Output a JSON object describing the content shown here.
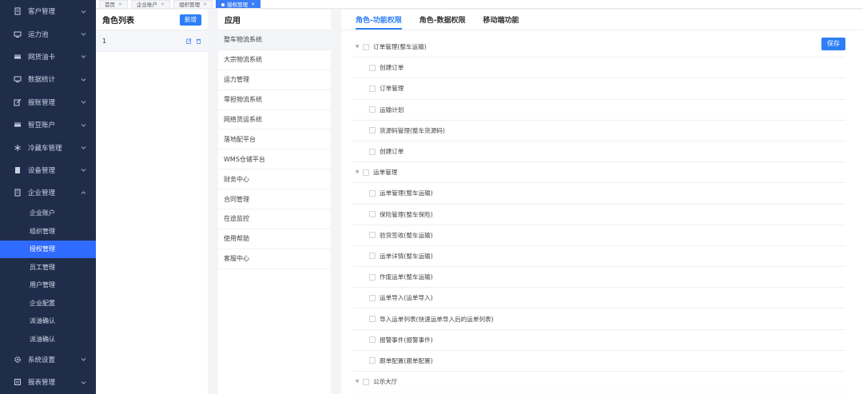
{
  "sidebar": {
    "items": [
      {
        "label": "客户管理",
        "icon": "document-icon",
        "expanded": false
      },
      {
        "label": "运力池",
        "icon": "monitor-icon",
        "expanded": false
      },
      {
        "label": "网货油卡",
        "icon": "card-icon",
        "expanded": false
      },
      {
        "label": "数据统计",
        "icon": "monitor-icon",
        "expanded": false
      },
      {
        "label": "报账管理",
        "icon": "edit-icon",
        "expanded": false
      },
      {
        "label": "智豆账户",
        "icon": "card-icon",
        "expanded": false
      },
      {
        "label": "冷藏车管理",
        "icon": "snowflake-icon",
        "expanded": false
      },
      {
        "label": "设备管理",
        "icon": "device-icon",
        "expanded": false
      },
      {
        "label": "企业管理",
        "icon": "building-icon",
        "expanded": true
      }
    ],
    "subitems": [
      {
        "label": "企业账户",
        "active": false
      },
      {
        "label": "组织管理",
        "active": false
      },
      {
        "label": "授权管理",
        "active": true
      },
      {
        "label": "员工管理",
        "active": false
      },
      {
        "label": "用户管理",
        "active": false
      },
      {
        "label": "企业配置",
        "active": false
      },
      {
        "label": "派油确认",
        "active": false
      },
      {
        "label": "派油确认",
        "active": false
      }
    ],
    "bottom_items": [
      {
        "label": "系统设置",
        "icon": "gear-icon",
        "expanded": false
      },
      {
        "label": "报表管理",
        "icon": "report-icon",
        "expanded": false
      }
    ]
  },
  "tabs": [
    {
      "label": "首页",
      "active": false
    },
    {
      "label": "企业账户",
      "active": false
    },
    {
      "label": "组织管理",
      "active": false
    },
    {
      "label": "授权管理",
      "active": true
    }
  ],
  "roles": {
    "title": "角色列表",
    "add_label": "新增",
    "items": [
      {
        "label": "1"
      }
    ]
  },
  "apps": {
    "title": "应用",
    "items": [
      "整车物流系统",
      "大宗物流系统",
      "运力管理",
      "零担物流系统",
      "网络货运系统",
      "落地配平台",
      "WMS仓储平台",
      "财务中心",
      "合同管理",
      "在途监控",
      "使用帮助",
      "客服中心"
    ],
    "active_index": 0
  },
  "permissions": {
    "tabs": [
      {
        "label": "角色-功能权限",
        "active": true
      },
      {
        "label": "角色-数据权限",
        "active": false
      },
      {
        "label": "移动端功能",
        "active": false
      }
    ],
    "save_label": "保存",
    "rows": [
      {
        "label": "订单管理(整车运输)",
        "group": true
      },
      {
        "label": "创建订单",
        "group": false
      },
      {
        "label": "订单管理",
        "group": false
      },
      {
        "label": "运输计划",
        "group": false
      },
      {
        "label": "货源码管理(整车货源码)",
        "group": false
      },
      {
        "label": "创建订单",
        "group": false
      },
      {
        "label": "运单管理",
        "group": true
      },
      {
        "label": "运单管理(整车运输)",
        "group": false
      },
      {
        "label": "保险管理(整车保险)",
        "group": false
      },
      {
        "label": "验货签收(整车运输)",
        "group": false
      },
      {
        "label": "运单详情(整车运输)",
        "group": false
      },
      {
        "label": "作废运单(整车运输)",
        "group": false
      },
      {
        "label": "运单导入(运单导入)",
        "group": false
      },
      {
        "label": "导入运单列表(快速运单导入后的运单列表)",
        "group": false
      },
      {
        "label": "报警事件(报警事件)",
        "group": false
      },
      {
        "label": "跟单配置(跟单配置)",
        "group": false
      },
      {
        "label": "公示大厅",
        "group": true
      }
    ]
  },
  "colors": {
    "sidebar_bg": "#1f2d4b",
    "accent": "#2d7ef7",
    "active_menu": "#2f6bff"
  }
}
